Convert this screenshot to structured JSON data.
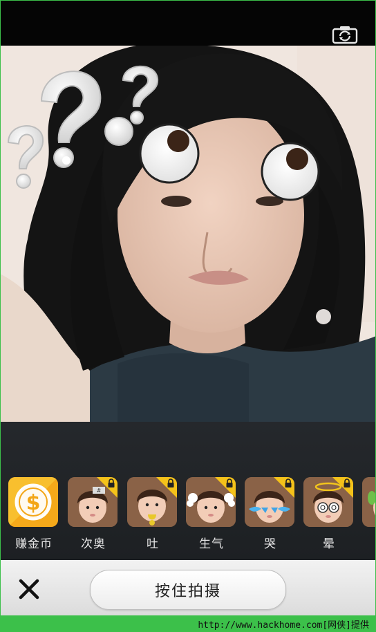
{
  "toolbar": {
    "flip_camera_icon": "camera-flip-icon"
  },
  "stickers": [
    {
      "label": "赚金币",
      "locked": false,
      "icon": "gold-coin-icon"
    },
    {
      "label": "次奥",
      "locked": true,
      "icon": "baby-face-icon"
    },
    {
      "label": "吐",
      "locked": true,
      "icon": "baby-face-icon"
    },
    {
      "label": "生气",
      "locked": true,
      "icon": "baby-face-icon"
    },
    {
      "label": "哭",
      "locked": true,
      "icon": "baby-face-icon"
    },
    {
      "label": "晕",
      "locked": true,
      "icon": "baby-face-icon"
    }
  ],
  "bottom": {
    "close_icon": "close-icon",
    "shoot_label": "按住拍摄"
  },
  "watermark": {
    "text": "http://www.hackhome.com[网侠]提供"
  },
  "colors": {
    "accent_green": "#3cc04a",
    "lock_yellow": "#f4c21a",
    "tray_bg": "#23262a"
  }
}
